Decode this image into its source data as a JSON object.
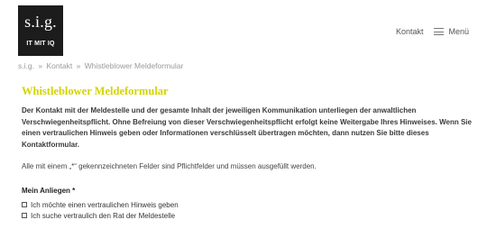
{
  "header": {
    "logo": {
      "wordmark": "s.i.g.",
      "tagline": "IT MIT IQ"
    },
    "nav": {
      "contact_label": "Kontakt",
      "menu_label": "Menü",
      "menu_icon": "hamburger-icon"
    }
  },
  "breadcrumb": {
    "items": [
      "s.i.g.",
      "Kontakt",
      "Whistleblower Meldeformular"
    ],
    "separator": "»"
  },
  "main": {
    "title": "Whistleblower Meldeformular",
    "intro": "Der Kontakt mit der Meldestelle und der gesamte Inhalt der jeweiligen Kommunikation unterliegen der anwaltlichen Verschwiegenheitspflicht. Ohne Befreiung von dieser Verschwiegenheitspflicht erfolgt keine Weitergabe Ihres Hinweises. Wenn Sie einen vertraulichen Hinweis geben oder Informationen verschlüsselt übertragen möchten, dann nutzen Sie bitte dieses Kontaktformular.",
    "required_note": "Alle mit einem „*“ gekennzeichneten Felder sind Pflichtfelder und müssen ausgefüllt werden.",
    "form": {
      "concern_label": "Mein Anliegen *",
      "options": [
        {
          "label": "Ich möchte einen vertraulichen Hinweis geben",
          "checked": false
        },
        {
          "label": "Ich suche vertraulich den Rat der Meldestelle",
          "checked": false
        }
      ]
    }
  },
  "colors": {
    "title_accent": "#d4d400",
    "logo_background": "#1c1c1c"
  }
}
